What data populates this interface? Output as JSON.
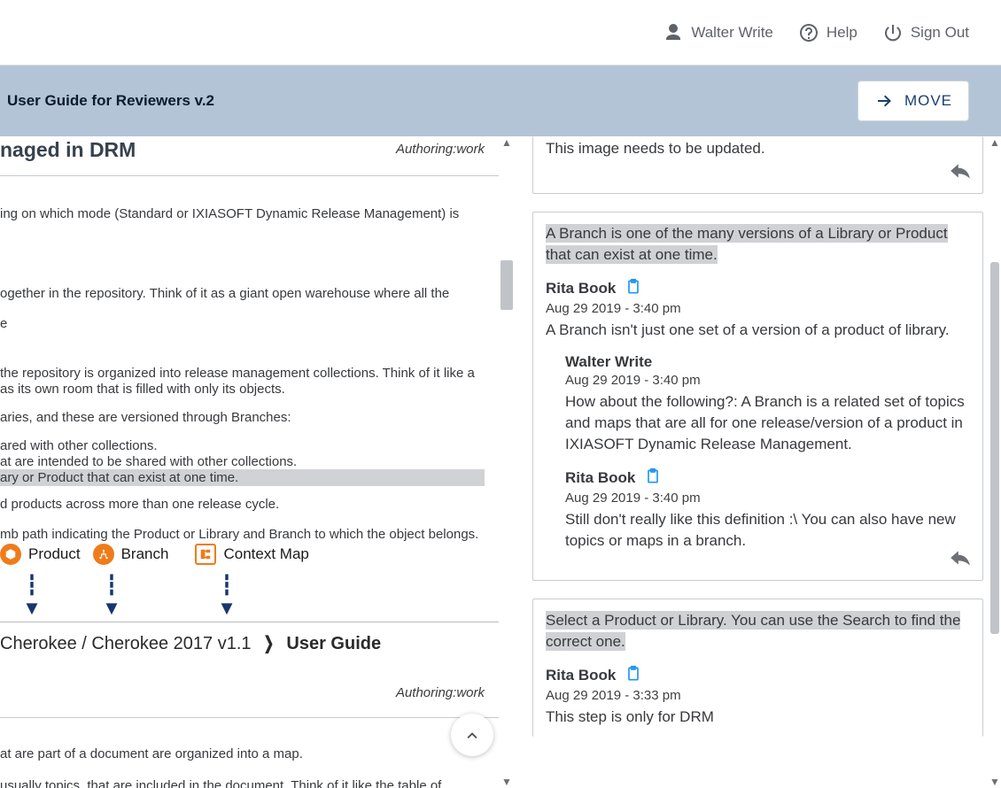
{
  "topbar": {
    "user": "Walter Write",
    "help": "Help",
    "signout": "Sign Out"
  },
  "titlebar": {
    "title": "User Guide for Reviewers v.2",
    "move": "MOVE"
  },
  "left": {
    "heading": "naged in DRM",
    "authoring": "Authoring:work",
    "lines": {
      "l1": "ing on which mode (Standard or IXIASOFT Dynamic Release Management) is",
      "l2": "ogether in the repository. Think of it as a giant open warehouse where all the",
      "l3": "e",
      "l4a": " the repository is organized into release management collections. Think of it like a",
      "l4b": "as its own room that is filled with only its objects.",
      "l5": "aries, and these are versioned through Branches:",
      "l6": "ared with other collections.",
      "l7": "at are intended to be shared with other collections.",
      "l8": "ary or Product that can exist at one time.",
      "l9": "d products across more than one release cycle.",
      "l10": "mb path indicating the Product or Library and Branch to which the object belongs.",
      "l11": "at are part of a document are organized into a map.",
      "l12": " usually topics, that are included in the document. Think of it like the table of"
    },
    "diagram": {
      "product": "Product",
      "branch": "Branch",
      "map": "Context Map",
      "breadcrumb_left": "Cherokee / Cherokee 2017 v1.1",
      "breadcrumb_right": "User Guide"
    }
  },
  "right": {
    "partial_comment": "This image needs to be updated.",
    "cards": [
      {
        "quote": "A Branch is one of the many versions of a Library or Product that can exist at one time.",
        "comments": [
          {
            "author": "Rita Book",
            "clipboard": true,
            "date": "Aug 29 2019 - 3:40 pm",
            "body": "A Branch isn't just one set of a version of a product of library."
          },
          {
            "author": "Walter Write",
            "clipboard": false,
            "date": "Aug 29 2019 - 3:40 pm",
            "indent": true,
            "body": "How about the following?: A Branch is a related set of topics and maps that are all for one release/version of a product in IXIASOFT Dynamic Release Management."
          },
          {
            "author": "Rita Book",
            "clipboard": true,
            "date": "Aug 29 2019 - 3:40 pm",
            "indent": true,
            "body": "Still don't really like this definition :\\ You can also have new topics or maps in a branch."
          }
        ]
      },
      {
        "quote": "Select a Product or Library. You can use the Search to find the correct one.",
        "comments": [
          {
            "author": "Rita Book",
            "clipboard": true,
            "date": "Aug 29 2019 - 3:33 pm",
            "body": "This step is only for DRM"
          }
        ]
      }
    ]
  }
}
